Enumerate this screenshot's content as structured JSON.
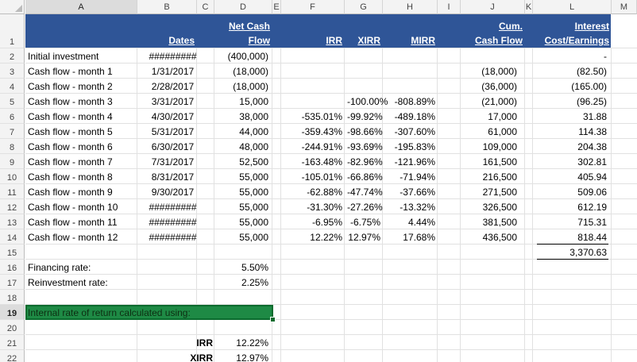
{
  "column_headers": [
    "A",
    "B",
    "C",
    "D",
    "E",
    "F",
    "G",
    "H",
    "I",
    "J",
    "K",
    "L",
    "M"
  ],
  "selected_column": "A",
  "row_numbers": [
    "1",
    "2",
    "3",
    "4",
    "5",
    "6",
    "7",
    "8",
    "9",
    "10",
    "11",
    "12",
    "13",
    "14",
    "15",
    "16",
    "17",
    "18",
    "19",
    "20",
    "21",
    "22"
  ],
  "selected_row": "19",
  "header": {
    "dates": "Dates",
    "net_cash_1": "Net Cash",
    "net_cash_2": "Flow",
    "irr": "IRR",
    "xirr": "XIRR",
    "mirr": "MIRR",
    "cum_1": "Cum.",
    "cum_2": "Cash Flow",
    "interest_1": "Interest",
    "interest_2": "Cost/Earnings"
  },
  "rows": [
    {
      "label": "Initial investment",
      "date": "#########",
      "flow": "(400,000)",
      "irr": "",
      "xirr": "",
      "mirr": "",
      "cum": "",
      "interest": "-"
    },
    {
      "label": "Cash flow - month 1",
      "date": "1/31/2017",
      "flow": "(18,000)",
      "irr": "",
      "xirr": "",
      "mirr": "",
      "cum": "(18,000)",
      "interest": "(82.50)"
    },
    {
      "label": "Cash flow - month 2",
      "date": "2/28/2017",
      "flow": "(18,000)",
      "irr": "",
      "xirr": "",
      "mirr": "",
      "cum": "(36,000)",
      "interest": "(165.00)"
    },
    {
      "label": "Cash flow - month 3",
      "date": "3/31/2017",
      "flow": "15,000",
      "irr": "",
      "xirr": "-100.00%",
      "mirr": "-808.89%",
      "cum": "(21,000)",
      "interest": "(96.25)"
    },
    {
      "label": "Cash flow - month 4",
      "date": "4/30/2017",
      "flow": "38,000",
      "irr": "-535.01%",
      "xirr": "-99.92%",
      "mirr": "-489.18%",
      "cum": "17,000",
      "interest": "31.88"
    },
    {
      "label": "Cash flow - month 5",
      "date": "5/31/2017",
      "flow": "44,000",
      "irr": "-359.43%",
      "xirr": "-98.66%",
      "mirr": "-307.60%",
      "cum": "61,000",
      "interest": "114.38"
    },
    {
      "label": "Cash flow - month 6",
      "date": "6/30/2017",
      "flow": "48,000",
      "irr": "-244.91%",
      "xirr": "-93.69%",
      "mirr": "-195.83%",
      "cum": "109,000",
      "interest": "204.38"
    },
    {
      "label": "Cash flow - month 7",
      "date": "7/31/2017",
      "flow": "52,500",
      "irr": "-163.48%",
      "xirr": "-82.96%",
      "mirr": "-121.96%",
      "cum": "161,500",
      "interest": "302.81"
    },
    {
      "label": "Cash flow - month 8",
      "date": "8/31/2017",
      "flow": "55,000",
      "irr": "-105.01%",
      "xirr": "-66.86%",
      "mirr": "-71.94%",
      "cum": "216,500",
      "interest": "405.94"
    },
    {
      "label": "Cash flow - month 9",
      "date": "9/30/2017",
      "flow": "55,000",
      "irr": "-62.88%",
      "xirr": "-47.74%",
      "mirr": "-37.66%",
      "cum": "271,500",
      "interest": "509.06"
    },
    {
      "label": "Cash flow - month 10",
      "date": "#########",
      "flow": "55,000",
      "irr": "-31.30%",
      "xirr": "-27.26%",
      "mirr": "-13.32%",
      "cum": "326,500",
      "interest": "612.19"
    },
    {
      "label": "Cash flow - month 11",
      "date": "#########",
      "flow": "55,000",
      "irr": "-6.95%",
      "xirr": "-6.75%",
      "mirr": "4.44%",
      "cum": "381,500",
      "interest": "715.31"
    },
    {
      "label": "Cash flow - month 12",
      "date": "#########",
      "flow": "55,000",
      "irr": "12.22%",
      "xirr": "12.97%",
      "mirr": "17.68%",
      "cum": "436,500",
      "interest": "818.44"
    }
  ],
  "interest_total": "3,370.63",
  "financing": {
    "label": "Financing rate:",
    "value": "5.50%"
  },
  "reinvestment": {
    "label": "Reinvestment rate:",
    "value": "2.25%"
  },
  "selected_cell_text": "Internal rate of return calculated using:",
  "summary": [
    {
      "label": "IRR",
      "value": "12.22%"
    },
    {
      "label": "XIRR",
      "value": "12.97%"
    }
  ]
}
